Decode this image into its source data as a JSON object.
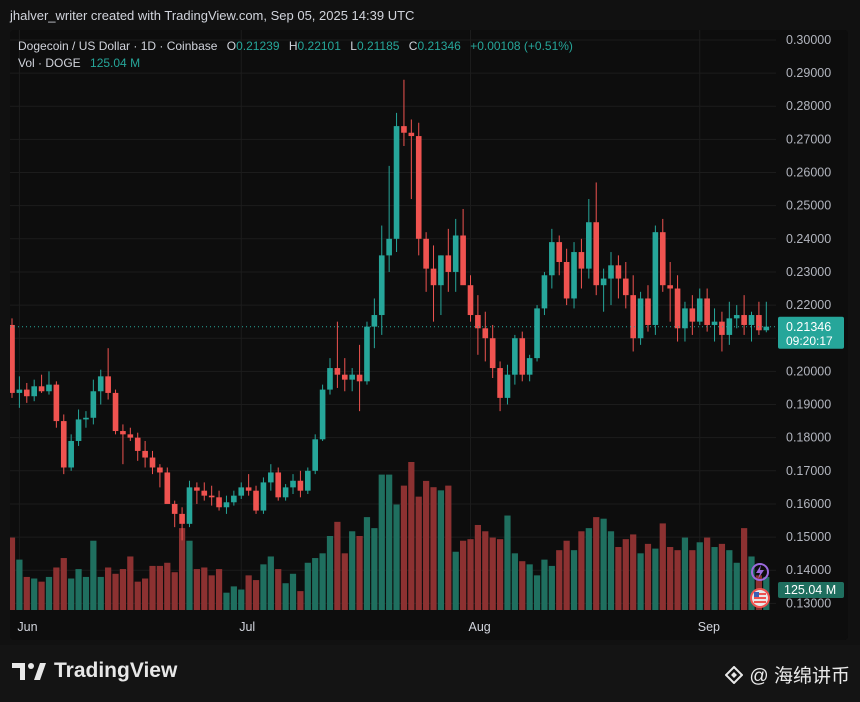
{
  "header": {
    "attribution": "jhalver_writer created with TradingView.com, Sep 05, 2025 14:39 UTC"
  },
  "legend": {
    "symbol": "Dogecoin / US Dollar · 1D · Coinbase",
    "open_label": "O",
    "open": "0.21239",
    "high_label": "H",
    "high": "0.22101",
    "low_label": "L",
    "low": "0.21185",
    "close_label": "C",
    "close": "0.21346",
    "change": "+0.00108 (+0.51%)",
    "vol_label": "Vol · DOGE",
    "vol_value": "125.04 M"
  },
  "price_badge": {
    "price": "0.21346",
    "countdown": "09:20:17"
  },
  "volume_badge": "125.04 M",
  "footer": {
    "brand": "TradingView",
    "watermark": "@ 海绵讲币"
  },
  "colors": {
    "up": "#26a69a",
    "down": "#ef5350",
    "up_vol": "#1f6f5f",
    "down_vol": "#8c3131"
  },
  "chart_data": {
    "type": "candlestick",
    "y_ticks": [
      "0.30000",
      "0.29000",
      "0.28000",
      "0.27000",
      "0.26000",
      "0.25000",
      "0.24000",
      "0.23000",
      "0.22000",
      "0.21000",
      "0.20000",
      "0.19000",
      "0.18000",
      "0.17000",
      "0.16000",
      "0.15000",
      "0.14000",
      "0.13000"
    ],
    "ylim": [
      0.128,
      0.303
    ],
    "x_ticks": [
      {
        "label": "Jun",
        "index": 1
      },
      {
        "label": "Jul",
        "index": 31
      },
      {
        "label": "Aug",
        "index": 62
      },
      {
        "label": "Sep",
        "index": 93
      }
    ],
    "current_price": 0.21346,
    "candles": [
      [
        0.214,
        0.216,
        0.192,
        0.1935
      ],
      [
        0.1935,
        0.1985,
        0.189,
        0.1945
      ],
      [
        0.1945,
        0.1965,
        0.1905,
        0.1925
      ],
      [
        0.1925,
        0.1975,
        0.191,
        0.1955
      ],
      [
        0.1955,
        0.199,
        0.1935,
        0.194
      ],
      [
        0.194,
        0.2,
        0.193,
        0.196
      ],
      [
        0.196,
        0.197,
        0.183,
        0.185
      ],
      [
        0.185,
        0.187,
        0.169,
        0.171
      ],
      [
        0.171,
        0.181,
        0.17,
        0.179
      ],
      [
        0.179,
        0.1885,
        0.1775,
        0.1855
      ],
      [
        0.1855,
        0.188,
        0.183,
        0.186
      ],
      [
        0.186,
        0.1975,
        0.184,
        0.194
      ],
      [
        0.194,
        0.2005,
        0.19,
        0.1985
      ],
      [
        0.1985,
        0.207,
        0.1915,
        0.1935
      ],
      [
        0.1935,
        0.1945,
        0.181,
        0.182
      ],
      [
        0.182,
        0.184,
        0.172,
        0.181
      ],
      [
        0.181,
        0.183,
        0.179,
        0.18
      ],
      [
        0.18,
        0.1815,
        0.173,
        0.176
      ],
      [
        0.176,
        0.179,
        0.171,
        0.174
      ],
      [
        0.174,
        0.176,
        0.169,
        0.171
      ],
      [
        0.171,
        0.172,
        0.165,
        0.1695
      ],
      [
        0.1695,
        0.171,
        0.163,
        0.16
      ],
      [
        0.16,
        0.161,
        0.153,
        0.157
      ],
      [
        0.157,
        0.159,
        0.149,
        0.154
      ],
      [
        0.154,
        0.167,
        0.153,
        0.165
      ],
      [
        0.165,
        0.1665,
        0.16,
        0.164
      ],
      [
        0.164,
        0.1665,
        0.161,
        0.1625
      ],
      [
        0.1625,
        0.1655,
        0.1595,
        0.162
      ],
      [
        0.162,
        0.164,
        0.158,
        0.159
      ],
      [
        0.159,
        0.1625,
        0.157,
        0.1605
      ],
      [
        0.1605,
        0.164,
        0.1595,
        0.1625
      ],
      [
        0.1625,
        0.1665,
        0.1615,
        0.165
      ],
      [
        0.165,
        0.169,
        0.1625,
        0.164
      ],
      [
        0.164,
        0.1655,
        0.157,
        0.158
      ],
      [
        0.158,
        0.168,
        0.157,
        0.1665
      ],
      [
        0.1665,
        0.172,
        0.164,
        0.1695
      ],
      [
        0.1695,
        0.171,
        0.161,
        0.162
      ],
      [
        0.162,
        0.166,
        0.161,
        0.165
      ],
      [
        0.165,
        0.169,
        0.163,
        0.167
      ],
      [
        0.167,
        0.17,
        0.162,
        0.164
      ],
      [
        0.164,
        0.171,
        0.163,
        0.17
      ],
      [
        0.17,
        0.181,
        0.169,
        0.1795
      ],
      [
        0.1795,
        0.196,
        0.179,
        0.1945
      ],
      [
        0.1945,
        0.204,
        0.193,
        0.201
      ],
      [
        0.201,
        0.215,
        0.195,
        0.199
      ],
      [
        0.199,
        0.204,
        0.194,
        0.1975
      ],
      [
        0.1975,
        0.201,
        0.194,
        0.199
      ],
      [
        0.199,
        0.208,
        0.188,
        0.197
      ],
      [
        0.197,
        0.215,
        0.196,
        0.2135
      ],
      [
        0.2135,
        0.222,
        0.207,
        0.217
      ],
      [
        0.217,
        0.244,
        0.211,
        0.235
      ],
      [
        0.235,
        0.262,
        0.23,
        0.24
      ],
      [
        0.24,
        0.278,
        0.236,
        0.274
      ],
      [
        0.274,
        0.288,
        0.268,
        0.272
      ],
      [
        0.272,
        0.276,
        0.252,
        0.271
      ],
      [
        0.271,
        0.275,
        0.235,
        0.24
      ],
      [
        0.24,
        0.242,
        0.224,
        0.231
      ],
      [
        0.231,
        0.238,
        0.215,
        0.226
      ],
      [
        0.226,
        0.235,
        0.217,
        0.235
      ],
      [
        0.235,
        0.243,
        0.224,
        0.23
      ],
      [
        0.23,
        0.246,
        0.224,
        0.241
      ],
      [
        0.241,
        0.249,
        0.232,
        0.226
      ],
      [
        0.226,
        0.229,
        0.215,
        0.217
      ],
      [
        0.217,
        0.223,
        0.205,
        0.213
      ],
      [
        0.213,
        0.218,
        0.203,
        0.21
      ],
      [
        0.21,
        0.214,
        0.198,
        0.201
      ],
      [
        0.201,
        0.203,
        0.188,
        0.192
      ],
      [
        0.192,
        0.202,
        0.19,
        0.199
      ],
      [
        0.199,
        0.211,
        0.196,
        0.21
      ],
      [
        0.21,
        0.212,
        0.197,
        0.199
      ],
      [
        0.199,
        0.205,
        0.197,
        0.204
      ],
      [
        0.204,
        0.22,
        0.203,
        0.219
      ],
      [
        0.219,
        0.23,
        0.217,
        0.229
      ],
      [
        0.229,
        0.243,
        0.225,
        0.239
      ],
      [
        0.239,
        0.241,
        0.229,
        0.233
      ],
      [
        0.233,
        0.237,
        0.22,
        0.222
      ],
      [
        0.222,
        0.239,
        0.219,
        0.236
      ],
      [
        0.236,
        0.24,
        0.225,
        0.231
      ],
      [
        0.231,
        0.252,
        0.228,
        0.245
      ],
      [
        0.245,
        0.257,
        0.223,
        0.226
      ],
      [
        0.226,
        0.231,
        0.218,
        0.228
      ],
      [
        0.228,
        0.236,
        0.22,
        0.232
      ],
      [
        0.232,
        0.235,
        0.222,
        0.228
      ],
      [
        0.228,
        0.233,
        0.219,
        0.223
      ],
      [
        0.223,
        0.229,
        0.206,
        0.21
      ],
      [
        0.21,
        0.224,
        0.208,
        0.222
      ],
      [
        0.222,
        0.226,
        0.212,
        0.214
      ],
      [
        0.214,
        0.244,
        0.211,
        0.242
      ],
      [
        0.242,
        0.246,
        0.224,
        0.226
      ],
      [
        0.226,
        0.233,
        0.215,
        0.225
      ],
      [
        0.225,
        0.229,
        0.209,
        0.213
      ],
      [
        0.213,
        0.221,
        0.209,
        0.219
      ],
      [
        0.219,
        0.223,
        0.211,
        0.215
      ],
      [
        0.215,
        0.225,
        0.214,
        0.222
      ],
      [
        0.222,
        0.225,
        0.212,
        0.214
      ],
      [
        0.214,
        0.219,
        0.209,
        0.215
      ],
      [
        0.215,
        0.218,
        0.206,
        0.211
      ],
      [
        0.211,
        0.221,
        0.208,
        0.216
      ],
      [
        0.216,
        0.22,
        0.213,
        0.217
      ],
      [
        0.217,
        0.223,
        0.211,
        0.214
      ],
      [
        0.214,
        0.218,
        0.209,
        0.217
      ],
      [
        0.217,
        0.221,
        0.211,
        0.2124
      ],
      [
        0.2124,
        0.221,
        0.2118,
        0.2135
      ]
    ],
    "volumes": [
      0.46,
      0.32,
      0.21,
      0.2,
      0.18,
      0.21,
      0.27,
      0.33,
      0.2,
      0.26,
      0.21,
      0.44,
      0.21,
      0.27,
      0.23,
      0.26,
      0.34,
      0.18,
      0.2,
      0.28,
      0.28,
      0.3,
      0.24,
      0.52,
      0.44,
      0.26,
      0.27,
      0.22,
      0.26,
      0.11,
      0.15,
      0.13,
      0.22,
      0.19,
      0.29,
      0.34,
      0.26,
      0.17,
      0.23,
      0.12,
      0.3,
      0.33,
      0.36,
      0.47,
      0.56,
      0.36,
      0.5,
      0.47,
      0.59,
      0.52,
      0.86,
      0.86,
      0.67,
      0.79,
      0.94,
      0.72,
      0.82,
      0.78,
      0.76,
      0.79,
      0.37,
      0.44,
      0.45,
      0.54,
      0.5,
      0.46,
      0.45,
      0.6,
      0.36,
      0.31,
      0.29,
      0.22,
      0.32,
      0.28,
      0.38,
      0.44,
      0.38,
      0.5,
      0.52,
      0.59,
      0.58,
      0.5,
      0.4,
      0.45,
      0.48,
      0.36,
      0.42,
      0.39,
      0.55,
      0.4,
      0.38,
      0.46,
      0.38,
      0.43,
      0.46,
      0.4,
      0.42,
      0.38,
      0.3,
      0.52,
      0.34,
      0.22,
      0.21
    ]
  }
}
